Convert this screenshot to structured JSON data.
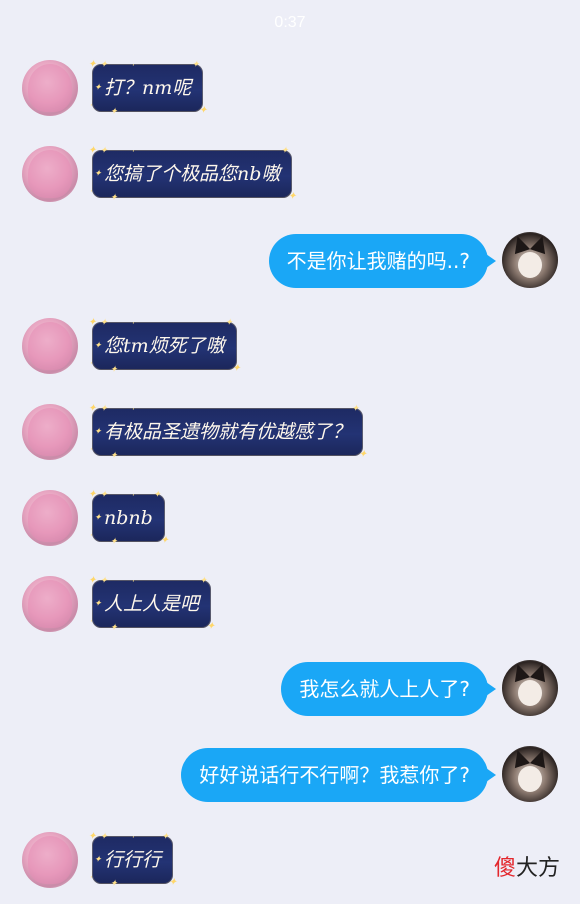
{
  "status_bar": {
    "time": "0:37"
  },
  "messages": [
    {
      "side": "left",
      "text": "打？nm呢"
    },
    {
      "side": "left",
      "text": "您搞了个极品您nb嗷"
    },
    {
      "side": "right",
      "text": "不是你让我赌的吗..?"
    },
    {
      "side": "left",
      "text": "您tm烦死了嗷"
    },
    {
      "side": "left",
      "text": "有极品圣遗物就有优越感了？"
    },
    {
      "side": "left",
      "text": "nbnb"
    },
    {
      "side": "left",
      "text": "人上人是吧"
    },
    {
      "side": "right",
      "text": "我怎么就人上人了?"
    },
    {
      "side": "right",
      "text": "好好说话行不行啊？我惹你了?"
    },
    {
      "side": "left",
      "text": "行行行"
    }
  ],
  "watermark": {
    "highlight": "傻",
    "rest": "大方"
  },
  "colors": {
    "background": "#edeef7",
    "outgoing_bubble": "#1aa7f6",
    "incoming_bubble": "#1e2a63",
    "accent_star": "#ffd76a"
  }
}
